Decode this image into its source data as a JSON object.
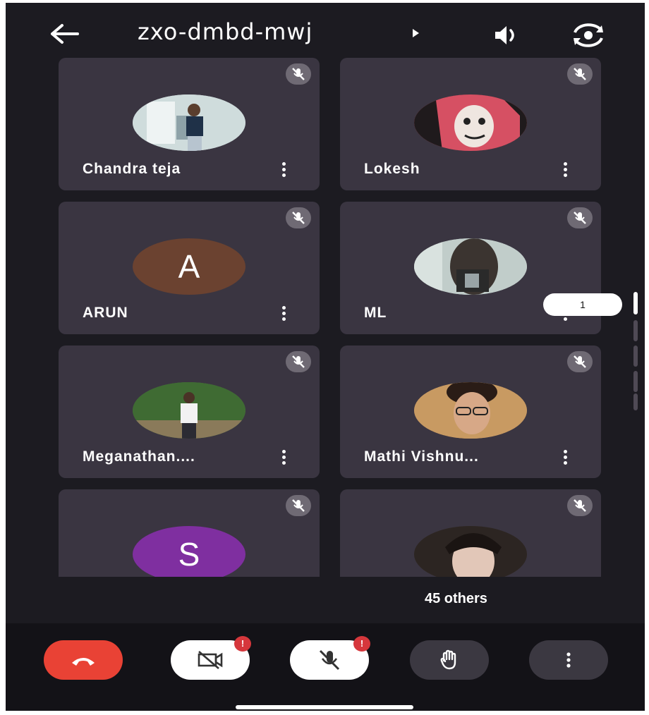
{
  "header": {
    "meeting_code": "zxo-dmbd-mwj"
  },
  "participants": [
    {
      "name": "Chandra teja",
      "avatar": "photo",
      "color": "#c9d6d6"
    },
    {
      "name": "Lokesh",
      "avatar": "photo",
      "color": "#d9646e"
    },
    {
      "name": "ARUN",
      "avatar": "A",
      "color": "#6b4230"
    },
    {
      "name": "ML",
      "avatar": "photo",
      "color": "#b9c7c4"
    },
    {
      "name": "Meganathan....",
      "avatar": "photo",
      "color": "#4c7a3c"
    },
    {
      "name": "Mathi Vishnu...",
      "avatar": "photo",
      "color": "#b88c5a"
    },
    {
      "name": "",
      "avatar": "S",
      "color": "#7f2fa0"
    },
    {
      "name": "",
      "avatar": "photo",
      "color": "#3c3530"
    }
  ],
  "page_indicator": "1",
  "others_label": "45 others",
  "controls": {
    "end_call_color": "#e94235",
    "camera_alert": "!",
    "mic_alert": "!"
  }
}
